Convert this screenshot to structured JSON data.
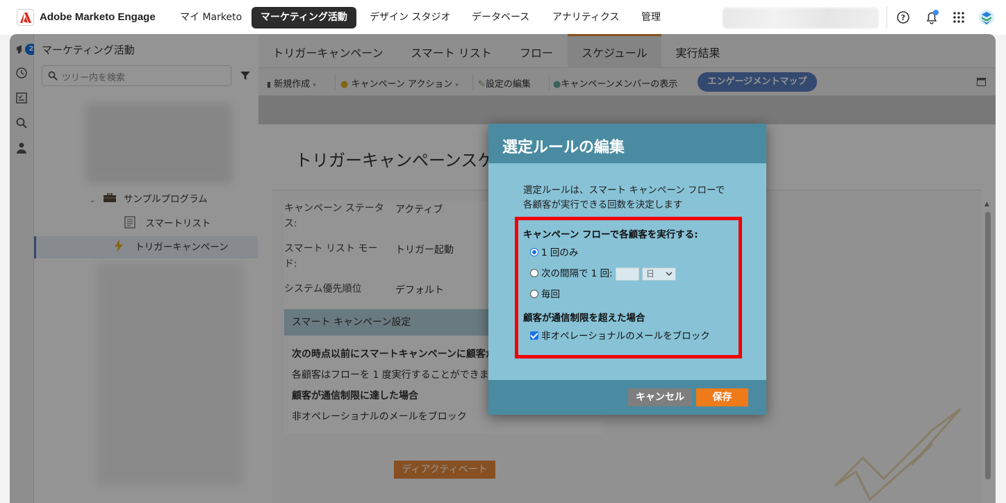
{
  "topbar": {
    "app_name": "Adobe Marketo Engage",
    "nav": [
      {
        "label": "マイ Marketo",
        "active": false
      },
      {
        "label": "マーケティング活動",
        "active": true
      },
      {
        "label": "デザイン スタジオ",
        "active": false
      },
      {
        "label": "データベース",
        "active": false
      },
      {
        "label": "アナリティクス",
        "active": false
      },
      {
        "label": "管理",
        "active": false
      }
    ],
    "notification_count": "2"
  },
  "tree": {
    "title": "マーケティング活動",
    "search_placeholder": "ツリー内を検索",
    "items": [
      {
        "label": "サンプルプログラム",
        "icon": "briefcase-icon"
      },
      {
        "label": "スマートリスト",
        "icon": "smart-list-icon"
      },
      {
        "label": "トリガーキャンペーン",
        "icon": "lightning-icon",
        "selected": true
      }
    ]
  },
  "tabs": [
    "トリガーキャンペーン",
    "スマート リスト",
    "フロー",
    "スケジュール",
    "実行結果"
  ],
  "active_tab": "スケジュール",
  "toolbar": {
    "new": "新規作成",
    "campaign_actions": "キャンペーン アクション",
    "edit_settings": "設定の編集",
    "show_members": "キャンペーンメンバーの表示",
    "engagement_map": "エンゲージメントマップ"
  },
  "content": {
    "title": "トリガーキャンペーンスケ",
    "props": [
      {
        "label": "キャンペーン ステータス:",
        "value": "アクティブ"
      },
      {
        "label": "スマート リスト モード:",
        "value": "トリガー起動"
      },
      {
        "label": "システム優先順位",
        "value": "デフォルト"
      }
    ],
    "settings_header": "スマート キャンペーン設定",
    "settings_lines": [
      "次の時点以前にスマートキャンペーンに顧客が",
      "各顧客はフローを 1 度実行することができま",
      "顧客が通信制限に達した場合",
      "非オペレーショナルのメールをブロック"
    ],
    "deactivate": "ディアクティベート"
  },
  "modal": {
    "title": "選定ルールの編集",
    "description_line1": "選定ルールは、スマート キャンペーン フローで",
    "description_line2": "各顧客が実行できる回数を決定します",
    "run_label": "キャンペーン フローで各顧客を実行する:",
    "options": {
      "once": "1 回のみ",
      "interval": "次の間隔で 1 回:",
      "every": "毎回"
    },
    "selected_option": "once",
    "interval_unit": "日",
    "limit_label": "顧客が通信制限を超えた場合",
    "block_label": "非オペレーショナルのメールをブロック",
    "block_checked": true,
    "cancel": "キャンセル",
    "save": "保存"
  }
}
